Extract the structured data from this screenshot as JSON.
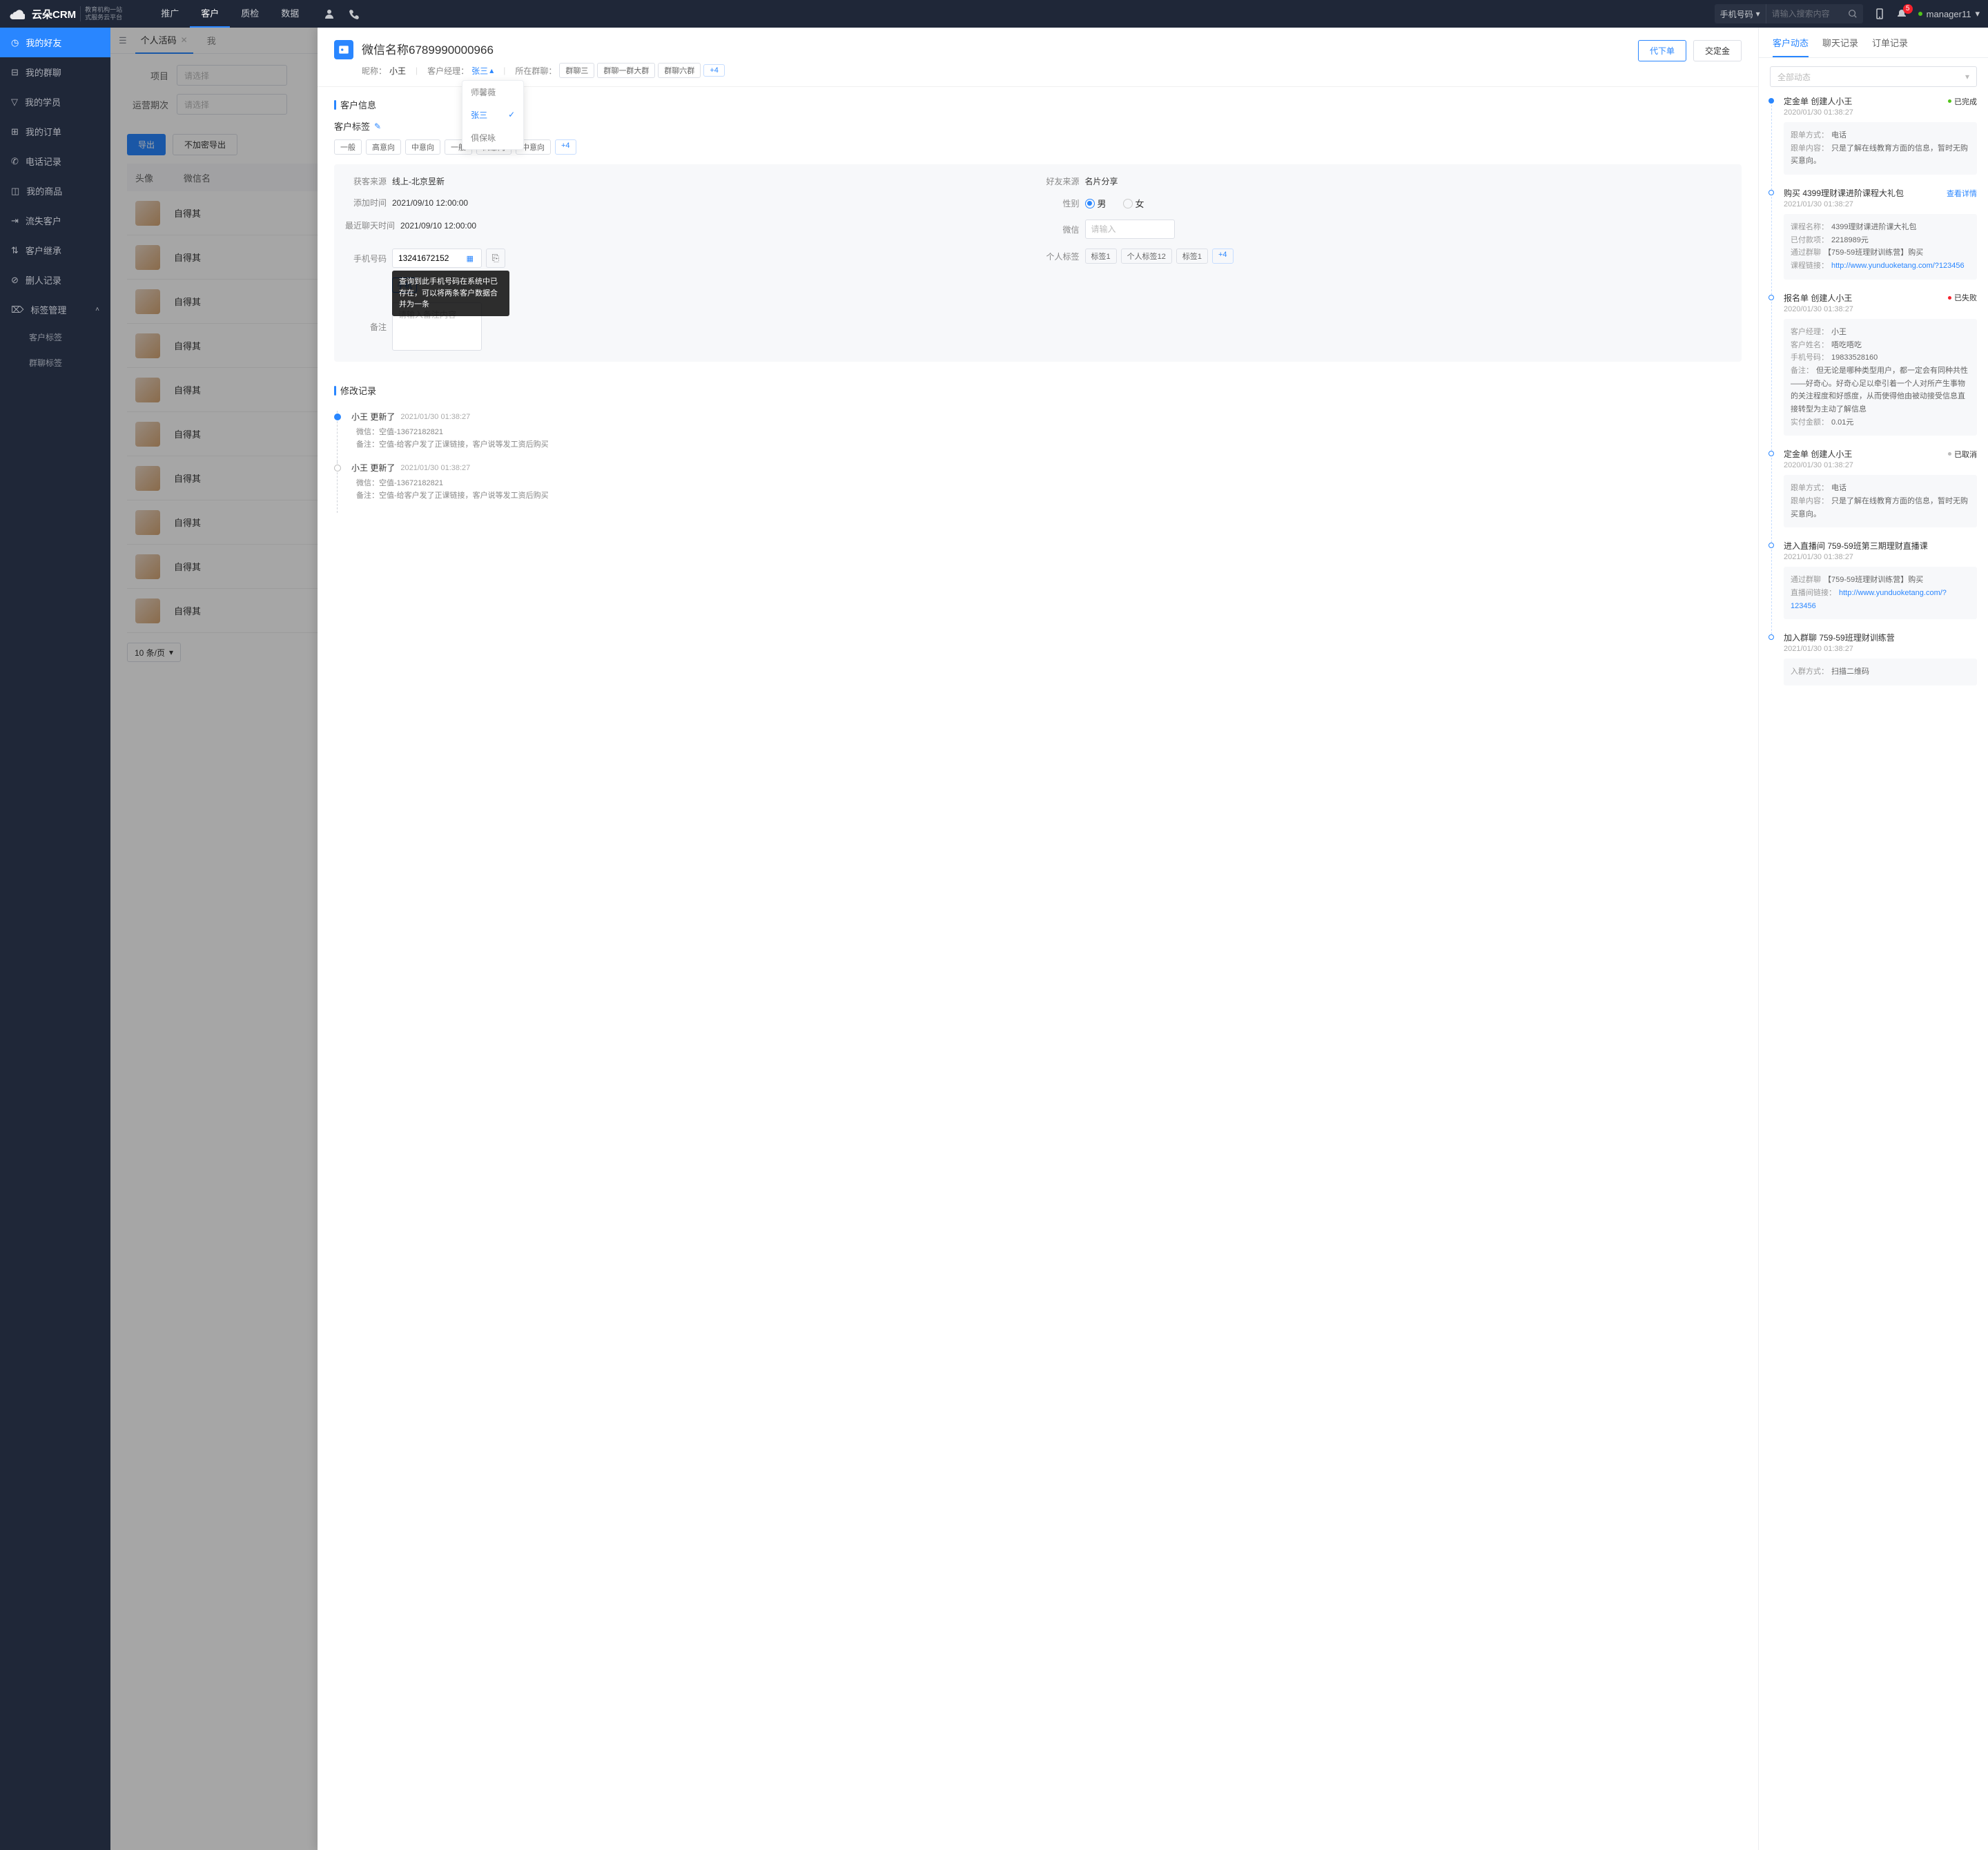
{
  "topbar": {
    "logo": "云朵CRM",
    "logo_sub1": "教育机构一站",
    "logo_sub2": "式服务云平台",
    "tabs": [
      "推广",
      "客户",
      "质检",
      "数据"
    ],
    "active_tab": 1,
    "search_type": "手机号码",
    "search_placeholder": "请输入搜索内容",
    "badge": "5",
    "user": "manager11"
  },
  "sidebar": {
    "items": [
      {
        "icon": "clock",
        "label": "我的好友",
        "active": true
      },
      {
        "icon": "msg",
        "label": "我的群聊"
      },
      {
        "icon": "filter",
        "label": "我的学员"
      },
      {
        "icon": "cart",
        "label": "我的订单"
      },
      {
        "icon": "phone",
        "label": "电话记录"
      },
      {
        "icon": "box",
        "label": "我的商品"
      },
      {
        "icon": "exit",
        "label": "流失客户"
      },
      {
        "icon": "inherit",
        "label": "客户继承"
      },
      {
        "icon": "del",
        "label": "删人记录"
      },
      {
        "icon": "tag",
        "label": "标签管理",
        "expanded": true
      }
    ],
    "subs": [
      "客户标签",
      "群聊标签"
    ]
  },
  "bg": {
    "tab_name": "个人活码",
    "tab2": "我",
    "filters": [
      {
        "label": "项目",
        "ph": "请选择"
      },
      {
        "label": "运营期次",
        "ph": "请选择"
      }
    ],
    "btns": {
      "export": "导出",
      "noenc": "不加密导出"
    },
    "cols": [
      "头像",
      "微信名"
    ],
    "col2_val": "自得其",
    "pager": "10 条/页"
  },
  "drawer": {
    "title": "微信名称6789990000966",
    "nickname_lbl": "昵称：",
    "nickname": "小王",
    "mgr_lbl": "客户经理：",
    "mgr": "张三",
    "group_lbl": "所在群聊：",
    "groups": [
      "群聊三",
      "群聊一群大群",
      "群聊六群"
    ],
    "group_more": "+4",
    "proxy_btn": "代下单",
    "deposit_btn": "交定金",
    "info_title": "客户信息",
    "tag_title": "客户标签",
    "tags": [
      "一般",
      "高意向",
      "中意向",
      "一般",
      "高意向",
      "中意向"
    ],
    "tag_more": "+4",
    "mgr_options": [
      "师馨薇",
      "张三",
      "俱保咏"
    ],
    "fields": {
      "source_lbl": "获客来源",
      "source": "线上-北京昱新",
      "friend_lbl": "好友来源",
      "friend": "名片分享",
      "add_time_lbl": "添加时间",
      "add_time": "2021/09/10 12:00:00",
      "gender_lbl": "性别",
      "male": "男",
      "female": "女",
      "last_chat_lbl": "最近聊天时间",
      "last_chat": "2021/09/10 12:00:00",
      "wechat_lbl": "微信",
      "wechat_ph": "请输入",
      "phone_lbl": "手机号码",
      "phone": "13241672152",
      "phone_tag": "手机",
      "phone_tooltip": "查询到此手机号码在系统中已存在，可以将两条客户数据合并为一条",
      "ptag_lbl": "个人标签",
      "ptags": [
        "标签1",
        "个人标签12",
        "标签1"
      ],
      "ptag_more": "+4",
      "remark_lbl": "备注",
      "remark_ph": "请输入备注内容"
    },
    "history_title": "修改记录",
    "history": [
      {
        "who": "小王 更新了",
        "time": "2021/01/30   01:38:27",
        "lines": [
          {
            "k": "微信：",
            "v": "空值-13672182821"
          },
          {
            "k": "备注：",
            "v": "空值-给客户发了正课链接，客户说等发工资后购买"
          }
        ]
      },
      {
        "who": "小王 更新了",
        "time": "2021/01/30   01:38:27",
        "lines": [
          {
            "k": "微信：",
            "v": "空值-13672182821"
          },
          {
            "k": "备注：",
            "v": "空值-给客户发了正课链接，客户说等发工资后购买"
          }
        ]
      }
    ]
  },
  "right": {
    "tabs": [
      "客户动态",
      "聊天记录",
      "订单记录"
    ],
    "filter_ph": "全部动态",
    "items": [
      {
        "dot": "filled",
        "title": "定金单 创建人小王",
        "status": "已完成",
        "status_color": "green",
        "time": "2020/01/30   01:38:27",
        "card": [
          {
            "k": "跟单方式：",
            "v": "电话"
          },
          {
            "k": "跟单内容：",
            "v": "只是了解在线教育方面的信息，暂时无购买意向。"
          }
        ]
      },
      {
        "dot": "",
        "title": "购买 4399理财课进阶课程大礼包",
        "detail": "查看详情",
        "time": "2021/01/30   01:38:27",
        "card": [
          {
            "k": "课程名称：",
            "v": "4399理财课进阶课大礼包"
          },
          {
            "k": "已付款项：",
            "v": "2218989元"
          },
          {
            "k": "通过群聊",
            "v": "【759-59班理财训练营】购买"
          },
          {
            "k": "课程链接：",
            "link": "http://www.yunduoketang.com/?123456"
          }
        ]
      },
      {
        "dot": "",
        "title": "报名单 创建人小王",
        "status": "已失败",
        "status_color": "red",
        "time": "2020/01/30   01:38:27",
        "card": [
          {
            "k": "客户经理：",
            "v": "小王"
          },
          {
            "k": "客户姓名：",
            "v": "唔吃唔吃"
          },
          {
            "k": "手机号码：",
            "v": "19833528160"
          },
          {
            "k": "备注：",
            "v": "但无论是哪种类型用户，都一定会有同种共性——好奇心。好奇心足以牵引着一个人对所产生事物的关注程度和好感度，从而使得他由被动接受信息直接转型为主动了解信息"
          },
          {
            "k": "实付金额：",
            "v": "0.01元"
          }
        ]
      },
      {
        "dot": "",
        "title": "定金单 创建人小王",
        "status": "已取消",
        "status_color": "gray",
        "time": "2020/01/30   01:38:27",
        "card": [
          {
            "k": "跟单方式：",
            "v": "电话"
          },
          {
            "k": "跟单内容：",
            "v": "只是了解在线教育方面的信息，暂时无购买意向。"
          }
        ]
      },
      {
        "dot": "",
        "title": "进入直播间 759-59班第三期理财直播课",
        "time": "2021/01/30   01:38:27",
        "card": [
          {
            "k": "通过群聊",
            "v": "【759-59班理财训练营】购买"
          },
          {
            "k": "直播间链接：",
            "link": "http://www.yunduoketang.com/?123456"
          }
        ]
      },
      {
        "dot": "",
        "title": "加入群聊 759-59班理财训练营",
        "time": "2021/01/30   01:38:27",
        "card": [
          {
            "k": "入群方式：",
            "v": "扫描二维码"
          }
        ]
      }
    ]
  }
}
